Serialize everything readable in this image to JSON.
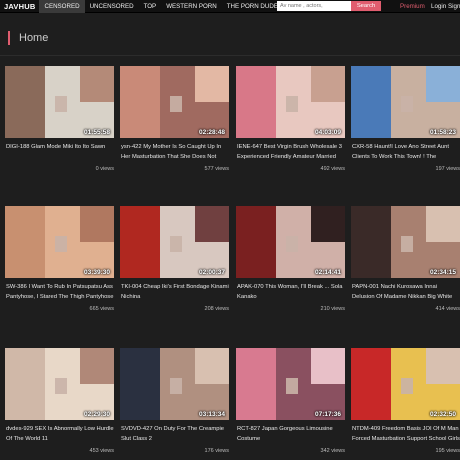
{
  "header": {
    "logo": "JAVHUB",
    "nav": [
      "CENSORED",
      "UNCENSORED",
      "TOP",
      "WESTERN PORN",
      "THE PORN DUDE"
    ],
    "search_placeholder": "Av name , actors,",
    "search_button": "Search",
    "premium": "Premium",
    "login": "Login",
    "signup": "Sign"
  },
  "page": {
    "heading": "Home"
  },
  "videos": [
    {
      "title": "DIGI-188 Glam Mode Miki Ito Ito Sawn",
      "views": "0 views",
      "duration": "01:55:58",
      "colors": [
        "#8a6a5a",
        "#d8d2c8",
        "#b48a78"
      ]
    },
    {
      "title": "ysn-422 My Mother Is So Caught Up In Her Masturbation That She Does Not Notice M...",
      "views": "577 views",
      "duration": "02:28:48",
      "colors": [
        "#c98a78",
        "#a06a60",
        "#e3b8a4"
      ]
    },
    {
      "title": "IENE-647 Best Virgin Brush Wholesale 3 Experienced Friendly Amateur Married Woma...",
      "views": "492 views",
      "duration": "04:03:09",
      "colors": [
        "#d87888",
        "#e8c8c0",
        "#c8a090"
      ]
    },
    {
      "title": "CXR-58 Haunt!I Love Ano Street Aunt Clients To Work This Town! ! The Fisherman O...",
      "views": "197 views",
      "duration": "01:58:23",
      "colors": [
        "#4a7ab8",
        "#c8b0a0",
        "#8ab0d8"
      ]
    },
    {
      "title": "SW-386 I Want To Rub In Patsupatsu Ass Pantyhose, I Stared The Thigh Pantyhose I...",
      "views": "665 views",
      "duration": "03:39:30",
      "colors": [
        "#c89070",
        "#e0b090",
        "#b07860"
      ]
    },
    {
      "title": "TKI-004 Cheap Iki's First Bondage Kinami Nichina",
      "views": "208 views",
      "duration": "02:00:37",
      "colors": [
        "#b02820",
        "#d8c8c0",
        "#704040"
      ]
    },
    {
      "title": "APAK-070 This Woman, I'll Break ... Sola Kanako",
      "views": "210 views",
      "duration": "02:14:41",
      "colors": [
        "#7a2020",
        "#d0b0a8",
        "#302020"
      ]
    },
    {
      "title": "PAPN-001 Nachi Kurosawa Innai Delusion Of Madame Nikkan Big White Booty 13",
      "views": "414 views",
      "duration": "02:34:15",
      "colors": [
        "#3a2a28",
        "#a88070",
        "#d8c0b0"
      ]
    },
    {
      "title": "dvdes-929 SEX Is Abnormally Low Hurdle Of The World 11",
      "views": "453 views",
      "duration": "02:29:30",
      "colors": [
        "#d0b8a8",
        "#e8d8c8",
        "#b08878"
      ]
    },
    {
      "title": "SVDVD-427 On Duty For The Creampie Slut Class 2",
      "views": "176 views",
      "duration": "03:13:34",
      "colors": [
        "#2a3040",
        "#b09080",
        "#d8c0b0"
      ]
    },
    {
      "title": "RCT-827 Japan Gorgeous Limousine Costume",
      "views": "342 views",
      "duration": "07:17:36",
      "colors": [
        "#d87a90",
        "#8a5060",
        "#e8c0c8"
      ]
    },
    {
      "title": "NTDM-409 Freedom Basis JOI Of M Man Forced Masturbation Support School Girls",
      "views": "195 views",
      "duration": "02:32:50",
      "colors": [
        "#c82828",
        "#e8c050",
        "#d8c0b0"
      ]
    }
  ]
}
